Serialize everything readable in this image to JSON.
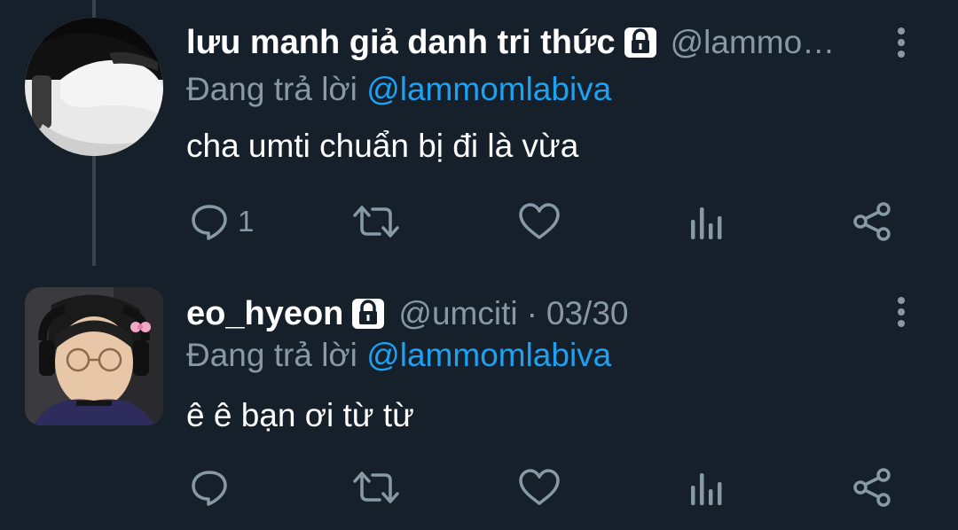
{
  "tweets": [
    {
      "display_name": "lưu manh giả danh tri thức",
      "handle": "@lammo…",
      "separator": "",
      "date": "",
      "reply_prefix": "Đang trả lời",
      "reply_to": "@lammomlabiva",
      "text": "cha umti chuẩn bị đi là vừa",
      "reply_count": "1",
      "protected": true
    },
    {
      "display_name": "eo_hyeon",
      "handle": "@umciti",
      "separator": "·",
      "date": "03/30",
      "reply_prefix": "Đang trả lời",
      "reply_to": "@lammomlabiva",
      "text": "ê ê bạn ơi từ từ",
      "reply_count": "",
      "protected": true
    }
  ],
  "icons": {
    "reply": "reply-icon",
    "retweet": "retweet-icon",
    "like": "heart-icon",
    "analytics": "analytics-icon",
    "share": "share-icon",
    "more": "more-vertical-icon",
    "lock": "lock-icon"
  },
  "colors": {
    "background": "#15202b",
    "text_primary": "#ffffff",
    "text_secondary": "#8899a6",
    "mention": "#1da1f2",
    "thread_line": "#38444d"
  }
}
